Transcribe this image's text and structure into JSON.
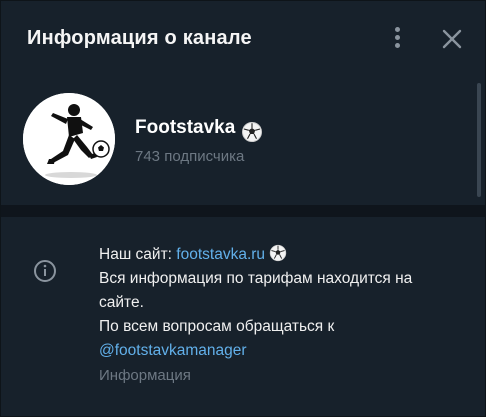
{
  "header": {
    "title": "Информация о канале",
    "menu_icon": "more-vertical-icon",
    "close_icon": "close-icon"
  },
  "channel": {
    "name": "Footstavka",
    "name_badge_icon": "soccer-ball-icon",
    "avatar_icon": "footballer-kicking-ball-icon",
    "subscribers": "743 подписчика"
  },
  "info": {
    "icon": "info-icon",
    "site_prefix": "Наш сайт: ",
    "site_link": "footstavka.ru",
    "site_badge_icon": "soccer-ball-icon",
    "line2": "Вся информация по тарифам находится на",
    "line3": "сайте.",
    "line4": "По всем вопросам обращаться к",
    "contact_link": "@footstavkamanager",
    "label": "Информация"
  },
  "colors": {
    "background": "#17212b",
    "link": "#62b0ea",
    "secondary_text": "#6d7883",
    "primary_text": "#f0f0f0"
  }
}
